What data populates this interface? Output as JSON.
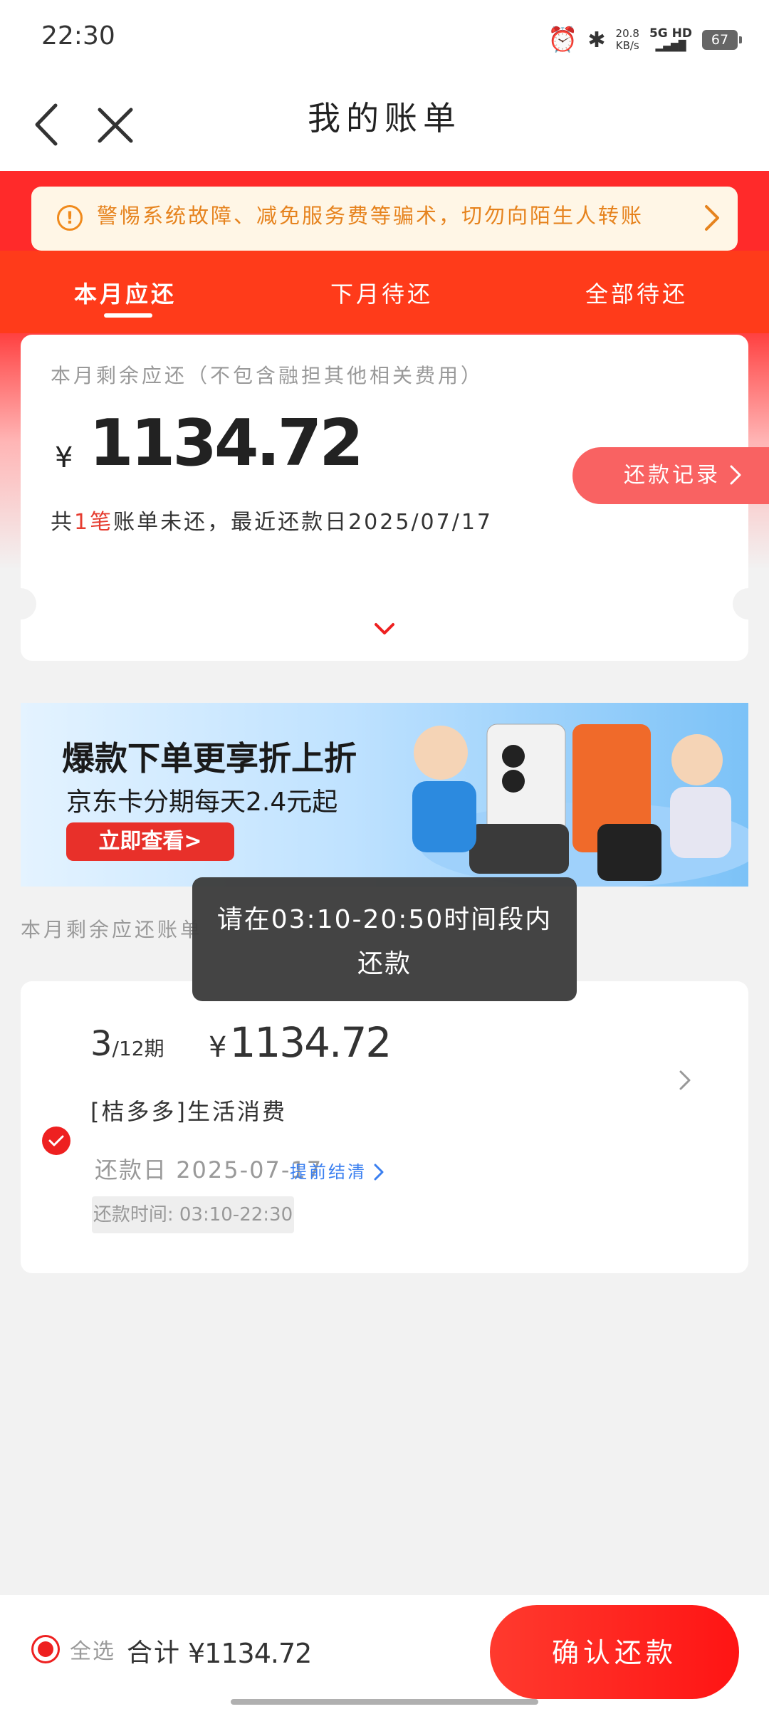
{
  "status_bar": {
    "time": "22:30",
    "speed": "20.8",
    "speed_unit": "KB/s",
    "network": "5G HD",
    "battery": "67",
    "icons": [
      "alarm-icon",
      "bluetooth-icon",
      "signal-icon",
      "battery-icon"
    ]
  },
  "header": {
    "title": "我的账单"
  },
  "notice": {
    "text": "警惕系统故障、减免服务费等骗术，切勿向陌生人转账"
  },
  "tabs": [
    {
      "label": "本月应还",
      "active": true
    },
    {
      "label": "下月待还",
      "active": false
    },
    {
      "label": "全部待还",
      "active": false
    }
  ],
  "summary": {
    "label": "本月剩余应还（不包含融担其他相关费用）",
    "currency": "¥",
    "amount": "1134.72",
    "info_prefix": "共",
    "count": "1笔",
    "info_suffix": "账单未还，最近还款日",
    "date": "2025/07/17",
    "repay_record_label": "还款记录"
  },
  "ad": {
    "headline": "爆款下单更享折上折",
    "subline": "京东卡分期每天2.4元起",
    "cta": "立即查看>"
  },
  "section_label": "本月剩余应还账单",
  "toast": {
    "line1": "请在03:10-20:50时间段内",
    "line2": "还款"
  },
  "bill": {
    "period_current": "3",
    "period_total": "/12期",
    "currency": "¥",
    "amount": "1134.72",
    "merchant": "[桔多多]生活消费",
    "due_label": "还款日",
    "due_date": "2025-07-17",
    "early_settle": "提前结清",
    "repay_time": "还款时间: 03:10-22:30"
  },
  "bottom": {
    "select_all": "全选",
    "total_label": "合计",
    "total_value": "¥1134.72",
    "confirm": "确认还款"
  },
  "colors": {
    "brand_red": "#ff2a2a",
    "notice_text": "#e6831e",
    "link_blue": "#3a7ff0"
  }
}
